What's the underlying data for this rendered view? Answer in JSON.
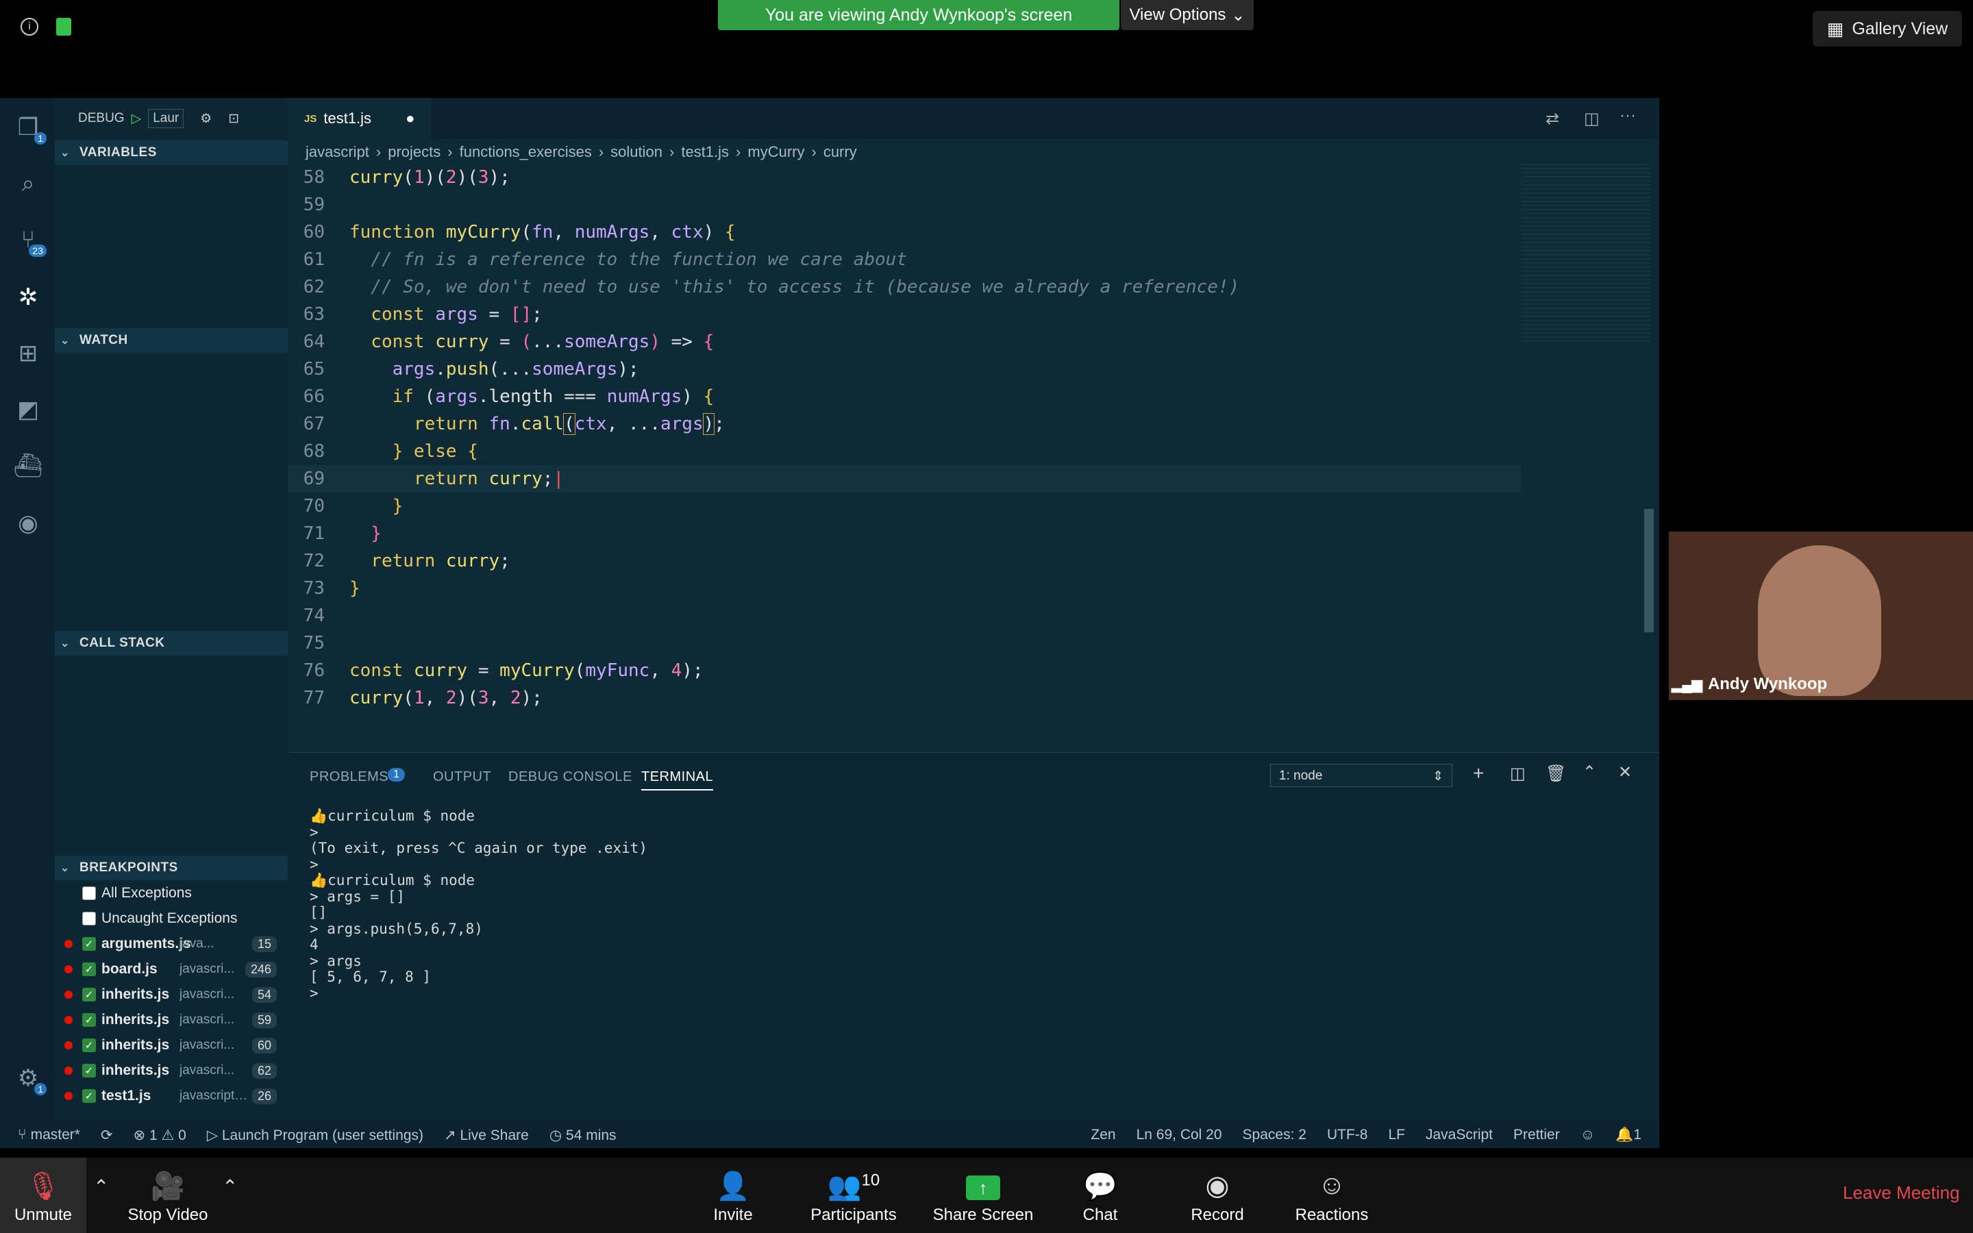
{
  "zoom_top": {
    "banner": "You are viewing Andy Wynkoop's screen",
    "view_options": "View Options",
    "gallery_view": "Gallery View"
  },
  "debug": {
    "label": "DEBUG",
    "config": "Laur"
  },
  "sidebar": {
    "variables": "VARIABLES",
    "watch": "WATCH",
    "call_stack": "CALL STACK",
    "breakpoints": "BREAKPOINTS",
    "exceptions": [
      "All Exceptions",
      "Uncaught Exceptions"
    ],
    "bp_items": [
      {
        "name": "arguments.js",
        "path": "java...",
        "line": "15"
      },
      {
        "name": "board.js",
        "path": "javascri...",
        "line": "246"
      },
      {
        "name": "inherits.js",
        "path": "javascri...",
        "line": "54"
      },
      {
        "name": "inherits.js",
        "path": "javascri...",
        "line": "59"
      },
      {
        "name": "inherits.js",
        "path": "javascri...",
        "line": "60"
      },
      {
        "name": "inherits.js",
        "path": "javascri...",
        "line": "62"
      },
      {
        "name": "test1.js",
        "path": "javascript/...",
        "line": "26"
      }
    ]
  },
  "activity_badges": {
    "explorer": "1",
    "scm": "23",
    "settings": "1"
  },
  "editor": {
    "tab": "test1.js",
    "tab_icon": "JS",
    "breadcrumbs": [
      "javascript",
      "projects",
      "functions_exercises",
      "solution",
      "test1.js",
      "myCurry",
      "curry"
    ]
  },
  "panel": {
    "tabs": [
      "PROBLEMS",
      "OUTPUT",
      "DEBUG CONSOLE",
      "TERMINAL"
    ],
    "problems_count": "1",
    "terminal_select": "1: node",
    "lines": [
      "👍curriculum $ node",
      ">",
      "(To exit, press ^C again or type .exit)",
      ">",
      "👍curriculum $ node",
      "> args = []",
      "[]",
      "> args.push(5,6,7,8)",
      "4",
      "> args",
      "[ 5, 6, 7, 8 ]",
      "> "
    ]
  },
  "status": {
    "branch": "master*",
    "errors": "⊗ 1 ⚠ 0",
    "launch": "Launch Program (user settings)",
    "live_share": "Live Share",
    "time": "54 mins",
    "zen": "Zen",
    "position": "Ln 69, Col 20",
    "spaces": "Spaces: 2",
    "encoding": "UTF-8",
    "eol": "LF",
    "language": "JavaScript",
    "prettier": "Prettier",
    "bell": "1"
  },
  "video": {
    "name": "Andy Wynkoop"
  },
  "bottom": {
    "unmute": "Unmute",
    "stop_video": "Stop Video",
    "invite": "Invite",
    "participants": "Participants",
    "participants_count": "10",
    "share": "Share Screen",
    "chat": "Chat",
    "record": "Record",
    "reactions": "Reactions",
    "leave": "Leave Meeting"
  },
  "colors": {
    "banner": "#2f9e44",
    "leave": "#e5484d",
    "share": "#27b14a"
  }
}
